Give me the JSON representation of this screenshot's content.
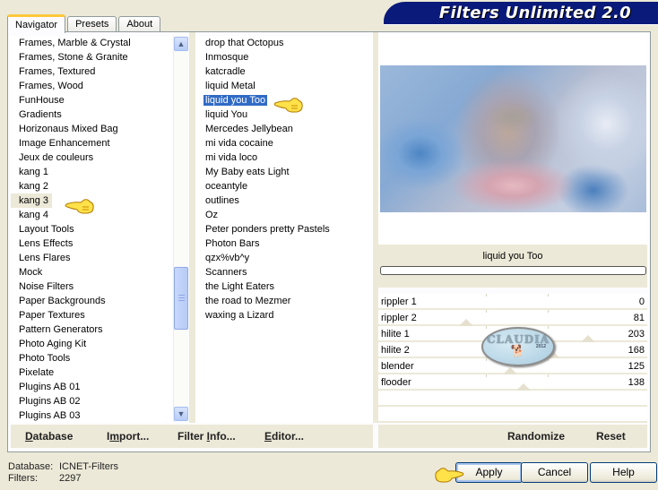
{
  "app": {
    "title": "Filters Unlimited 2.0"
  },
  "tabs": [
    {
      "label": "Navigator",
      "active": true
    },
    {
      "label": "Presets",
      "active": false
    },
    {
      "label": "About",
      "active": false
    }
  ],
  "categories": {
    "items": [
      "Frames, Marble & Crystal",
      "Frames, Stone & Granite",
      "Frames, Textured",
      "Frames, Wood",
      "FunHouse",
      "Gradients",
      "Horizonaus Mixed Bag",
      "Image Enhancement",
      "Jeux de couleurs",
      "kang 1",
      "kang 2",
      "kang 3",
      "kang 4",
      "Layout Tools",
      "Lens Effects",
      "Lens Flares",
      "Mock",
      "Noise Filters",
      "Paper Backgrounds",
      "Paper Textures",
      "Pattern Generators",
      "Photo Aging Kit",
      "Photo Tools",
      "Pixelate",
      "Plugins AB 01",
      "Plugins AB 02",
      "Plugins AB 03"
    ],
    "selected": "kang 3"
  },
  "filters": {
    "items": [
      "drop that Octopus",
      "Inmosque",
      "katcradle",
      "liquid Metal",
      "liquid you Too",
      "liquid You",
      "Mercedes Jellybean",
      "mi vida cocaine",
      "mi vida loco",
      "My Baby eats Light",
      "oceantyle",
      "outlines",
      "Oz",
      "Peter ponders pretty Pastels",
      "Photon Bars",
      "qzx%vb^y",
      "Scanners",
      "the Light Eaters",
      "the road to Mezmer",
      "waxing a Lizard"
    ],
    "selected": "liquid you Too"
  },
  "preview": {
    "filter_name": "liquid you Too",
    "progress": 0
  },
  "sliders": [
    {
      "label": "rippler 1",
      "value": 0,
      "max": 255
    },
    {
      "label": "rippler 2",
      "value": 81,
      "max": 255
    },
    {
      "label": "hilite 1",
      "value": 203,
      "max": 255
    },
    {
      "label": "hilite 2",
      "value": 168,
      "max": 255
    },
    {
      "label": "blender",
      "value": 125,
      "max": 255
    },
    {
      "label": "flooder",
      "value": 138,
      "max": 255
    }
  ],
  "actions_left": {
    "database": {
      "pre": "",
      "u": "D",
      "post": "atabase"
    },
    "import": {
      "pre": "I",
      "u": "m",
      "post": "port..."
    },
    "filter_info": {
      "pre": "Filter ",
      "u": "I",
      "post": "nfo..."
    },
    "editor": {
      "pre": "",
      "u": "E",
      "post": "ditor..."
    }
  },
  "actions_right": {
    "randomize": "Randomize",
    "reset": "Reset"
  },
  "status": {
    "database_label": "Database:",
    "database_value": "ICNET-Filters",
    "filters_label": "Filters:",
    "filters_value": "2297"
  },
  "buttons": {
    "apply": "Apply",
    "cancel": "Cancel",
    "help": "Help"
  },
  "watermark": {
    "text": "CLAUDIA",
    "year": "2012"
  }
}
